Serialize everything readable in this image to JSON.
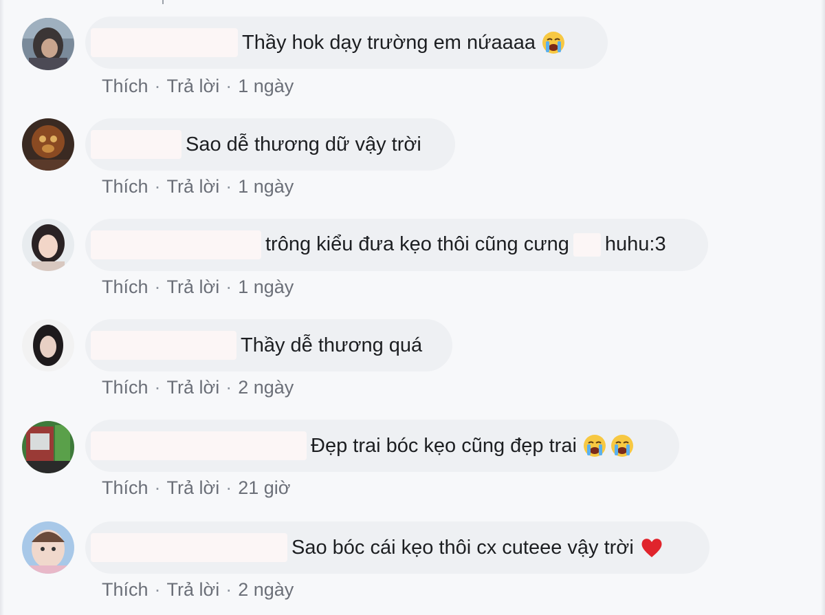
{
  "comments": [
    {
      "text": "Thầy hok dạy trường em nứaaaa",
      "emoji": [
        "crying-face-icon"
      ],
      "like_label": "Thích",
      "reply_label": "Trả lời",
      "time": "1 ngày"
    },
    {
      "text": "Sao dễ thương dữ vậy trời",
      "emoji": [],
      "like_label": "Thích",
      "reply_label": "Trả lời",
      "time": "1 ngày"
    },
    {
      "text_before": "trông kiểu đưa kẹo thôi cũng cưng",
      "text_after": "huhu:3",
      "emoji": [],
      "like_label": "Thích",
      "reply_label": "Trả lời",
      "time": "1 ngày"
    },
    {
      "text": "Thầy dễ thương quá",
      "emoji": [],
      "like_label": "Thích",
      "reply_label": "Trả lời",
      "time": "2 ngày"
    },
    {
      "text": "Đẹp trai bóc kẹo cũng đẹp trai",
      "emoji": [
        "crying-face-icon",
        "crying-face-icon"
      ],
      "like_label": "Thích",
      "reply_label": "Trả lời",
      "time": "21 giờ"
    },
    {
      "text": "Sao bóc cái kẹo thôi cx cuteee vậy trời",
      "emoji": [
        "red-heart-icon"
      ],
      "like_label": "Thích",
      "reply_label": "Trả lời",
      "time": "2 ngày"
    }
  ],
  "separator": "·"
}
